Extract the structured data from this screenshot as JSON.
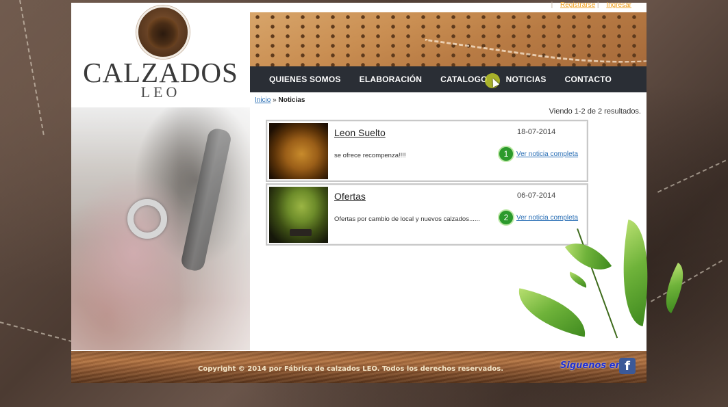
{
  "auth": {
    "register": "Registrarse",
    "separator": "|",
    "login": "Ingresar"
  },
  "logo": {
    "main": "CALZADOS",
    "sub": "LEO",
    "icon": "lion-icon"
  },
  "nav": {
    "items": [
      {
        "label": "QUIENES SOMOS"
      },
      {
        "label": "ELABORACIÓN"
      },
      {
        "label": "CATALOGO"
      },
      {
        "label": "NOTICIAS"
      },
      {
        "label": "CONTACTO"
      }
    ]
  },
  "breadcrumb": {
    "home": "Inicio",
    "separator": "»",
    "current": "Noticias"
  },
  "results_text": "Viendo 1-2 de 2 resultados.",
  "news": [
    {
      "title": "Leon Suelto",
      "date": "18-07-2014",
      "description": "se ofrece recompenza!!!!",
      "link": "Ver noticia completa",
      "badge": "1",
      "thumb": "lion-photo"
    },
    {
      "title": "Ofertas",
      "date": "06-07-2014",
      "description": "Ofertas por cambio de local y nuevos calzados......",
      "link": "Ver noticia completa",
      "badge": "2",
      "thumb": "bonsai-photo"
    }
  ],
  "footer": {
    "copyright": "Copyright © 2014 por Fábrica de calzados LEO. Todos los derechos reservados.",
    "follow": "Siguenos en:",
    "facebook_icon": "f"
  },
  "colors": {
    "nav_bg": "#2a2e35",
    "link": "#2a6fb5",
    "auth_link": "#f0a020",
    "badge": "#2c9a2c"
  }
}
